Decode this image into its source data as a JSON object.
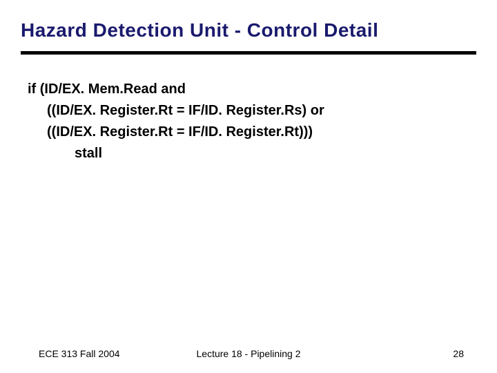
{
  "slide": {
    "title": "Hazard Detection Unit - Control Detail",
    "lines": {
      "l1": "if (ID/EX. Mem.Read and",
      "l2": "((ID/EX. Register.Rt = IF/ID. Register.Rs) or",
      "l3": "((ID/EX. Register.Rt = IF/ID. Register.Rt)))",
      "l4": "stall"
    }
  },
  "footer": {
    "left": "ECE 313 Fall 2004",
    "center": "Lecture 18 - Pipelining 2",
    "right": "28"
  }
}
